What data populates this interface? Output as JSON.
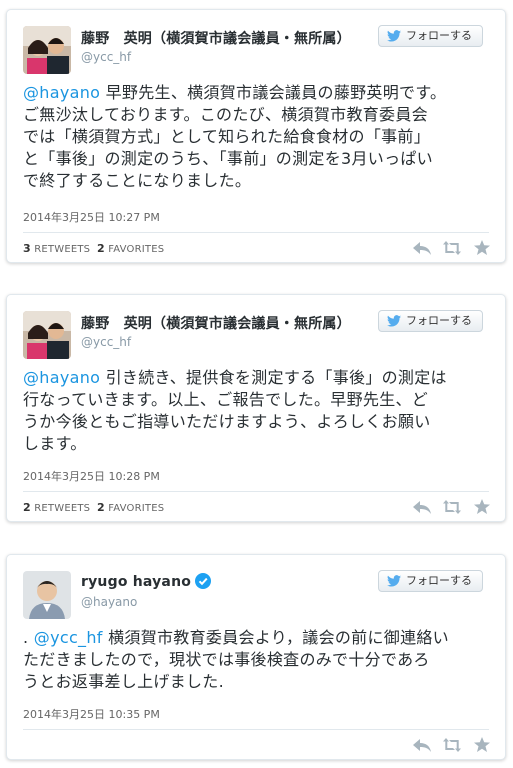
{
  "tweets": [
    {
      "author_name": "藤野　英明（横須賀市議会議員・無所属）",
      "handle": "@ycc_hf",
      "verified": false,
      "follow_label": "フォローする",
      "mention": "@hayano",
      "text": " 早野先生、横須賀市議会議員の藤野英明です。\nご無沙汰しております。このたび、横須賀市教育委員会\nでは「横須賀方式」として知られた給食食材の「事前」\nと「事後」の測定のうち、「事前」の測定を3月いっぱい\nで終了することになりました。",
      "date": "2014年3月25日 10:27 PM",
      "retweets": "3",
      "retweets_label": "RETWEETS",
      "favorites": "2",
      "favorites_label": "FAVORITES"
    },
    {
      "author_name": "藤野　英明（横須賀市議会議員・無所属）",
      "handle": "@ycc_hf",
      "verified": false,
      "follow_label": "フォローする",
      "mention": "@hayano",
      "text": " 引き続き、提供食を測定する「事後」の測定は\n行なっていきます。以上、ご報告でした。早野先生、ど\nうか今後ともご指導いただけますよう、よろしくお願い\nします。",
      "date": "2014年3月25日 10:28 PM",
      "retweets": "2",
      "retweets_label": "RETWEETS",
      "favorites": "2",
      "favorites_label": "FAVORITES"
    },
    {
      "author_name": "ryugo hayano",
      "handle": "@hayano",
      "verified": true,
      "follow_label": "フォローする",
      "prefix": ". ",
      "mention": "@ycc_hf",
      "text": " 横須賀市教育委員会より，議会の前に御連絡い\nただきましたので，現状では事後検査のみで十分であろ\nうとお返事差し上げました.",
      "date": "2014年3月25日 10:35 PM"
    }
  ],
  "colors": {
    "mention": "#1b95e0",
    "verified": "#1da1f2",
    "bird": "#55acee"
  },
  "icons": [
    "twitter-bird-icon",
    "verified-badge-icon",
    "reply-icon",
    "retweet-icon",
    "favorite-star-icon"
  ]
}
